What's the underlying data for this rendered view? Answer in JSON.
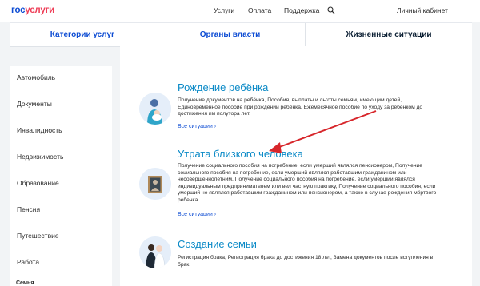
{
  "header": {
    "logo_part1": "гос",
    "logo_part2": "услуги",
    "nav_items": [
      "Услуги",
      "Оплата",
      "Поддержка"
    ],
    "cabinet_label": "Личный кабинет"
  },
  "tabs": [
    {
      "label": "Категории услуг"
    },
    {
      "label": "Органы власти"
    },
    {
      "label": "Жизненные ситуации",
      "active": true
    }
  ],
  "sidebar": {
    "items": [
      {
        "label": "Автомобиль"
      },
      {
        "label": "Документы"
      },
      {
        "label": "Инвалидность"
      },
      {
        "label": "Недвижимость"
      },
      {
        "label": "Образование"
      },
      {
        "label": "Пенсия"
      },
      {
        "label": "Путешествие"
      },
      {
        "label": "Работа"
      }
    ],
    "cutoff_label": "Семья"
  },
  "sections": [
    {
      "title": "Рождение ребёнка",
      "description": "Получение документов на ребёнка, Пособия, выплаты и льготы семьям, имеющим детей, Единовременное пособие при рождении ребёнка, Ежемесячное пособие по уходу за ребенком до достижения им полутора лет.",
      "link": "Все ситуации ›",
      "icon": "mother-baby-icon"
    },
    {
      "title": "Утрата близкого человека",
      "description": "Получение социального пособия на погребение, если умерший являлся пенсионером, Получение социального пособия на погребение, если умерший являлся работавшим гражданином или несовершеннолетним, Получение социального пособия на погребение, если умерший являлся индивидуальным предпринимателем или вел частную практику, Получение социального пособия, если умерший не являлся работавшим гражданином или пенсионером, а также в случае рождения мёртвого ребенка.",
      "link": "Все ситуации ›",
      "icon": "memorial-portrait-icon"
    },
    {
      "title": "Создание семьи",
      "description": "Регистрация брака, Регистрация брака до достижения 18 лет, Замена документов после вступления в брак.",
      "link": "",
      "icon": "wedding-couple-icon"
    }
  ],
  "colors": {
    "brand_blue": "#0d4cd3",
    "brand_red": "#ee3f58",
    "title_cyan": "#0b8ac7",
    "arrow_red": "#d7262b",
    "page_bg": "#f2f4f6"
  }
}
